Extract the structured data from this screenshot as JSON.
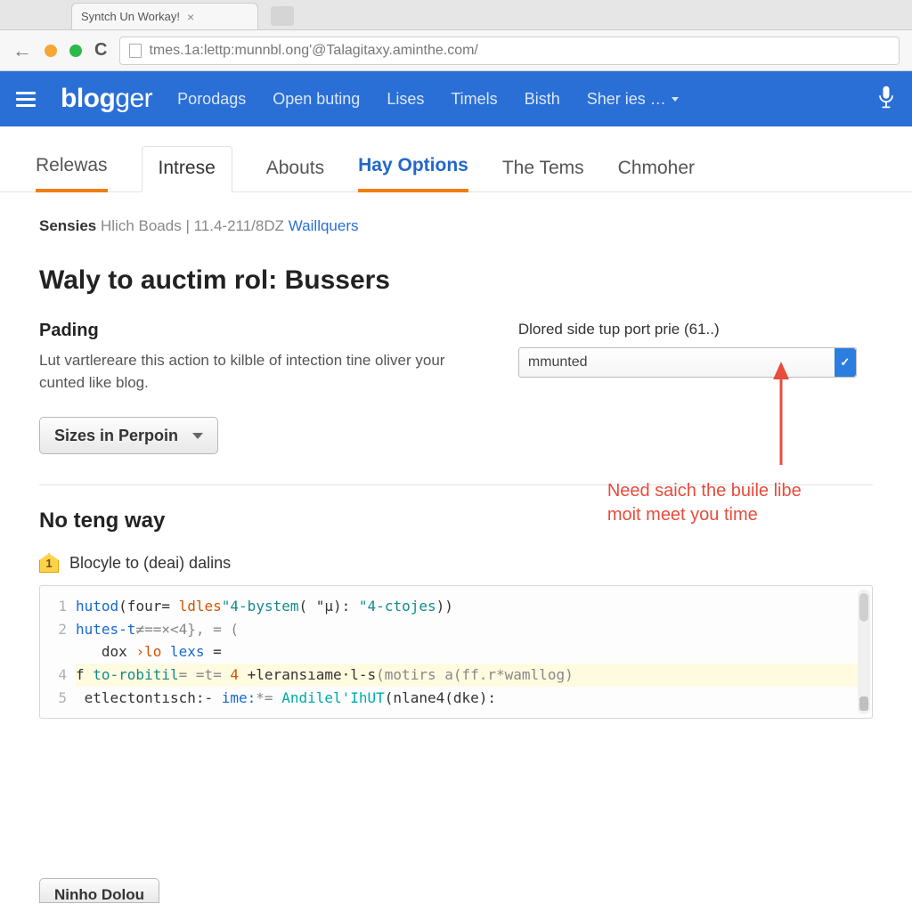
{
  "browser": {
    "tab_title": "Syntch Un Workay!",
    "url": "tmes.1a:lettp:munnbl.ong'@Talagitaxy.aminthe.com/"
  },
  "header": {
    "logo_main": "blog",
    "logo_suffix": "ger",
    "nav": [
      "Porodags",
      "Open buting",
      "Lises",
      "Timels",
      "Bisth",
      "Sher ies …"
    ]
  },
  "tabs": {
    "items": [
      "Relewas",
      "Intrese",
      "Abouts",
      "Hay Options",
      "The Tems",
      "Chmoher"
    ],
    "underlined_index": 0,
    "active_box_index": 1,
    "blue_index": 3
  },
  "breadcrumb": {
    "bold": "Sensies",
    "mid": "Hlich Boads",
    "sep": " | ",
    "code": "11.4-211/8DZ",
    "link": "Waillquers"
  },
  "title": "Waly to auctim rol: Bussers",
  "left": {
    "heading": "Pading",
    "desc": "Lut vartlereare this action to kilble of intection tine oliver your cunted like blog."
  },
  "right": {
    "label": "Dlored side tup port prie (61..)",
    "value": "mmunted"
  },
  "dropdown_btn": "Sizes in Perpoin",
  "section2": {
    "heading": "No teng way",
    "step_num": "1",
    "step_text": "Blocyle to (deai) dalins"
  },
  "code": {
    "l1a": "hutod",
    "l1b": "(four= ",
    "l1c": "ldles",
    "l1d": "\"4-bystem",
    "l1e": "( \"µ): ",
    "l1f": "\"4-ctojes",
    "l1g": "))",
    "l2a": "hutes-t",
    "l2b": "≠==×<4}, = (",
    "l3a": "   dox ",
    "l3b": "›lo ",
    "l3c": "lexs",
    "l3d": " =",
    "l4a": "f ",
    "l4b": "to-robitil",
    "l4c": "= =t= ",
    "l4d": "4 ",
    "l4e": "+leransıame·l-s",
    "l4f": "(motirs a(ff.r*wamllog)",
    "l5a": " etlectontısch:- ",
    "l5b": "ime:",
    "l5c": "*= ",
    "l5d": "Andilel'IhUT",
    "l5e": "(nlane4(dke):"
  },
  "annotation": {
    "line1": "Need saich the buile libe",
    "line2": "moit meet you time"
  },
  "bottom_button": "Ninho Dolou"
}
